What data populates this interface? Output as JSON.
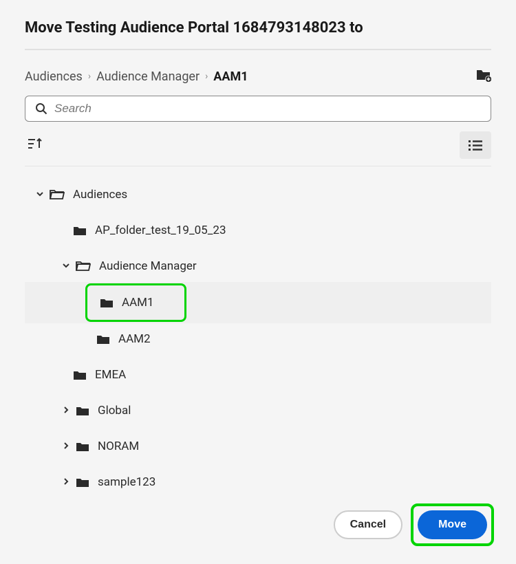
{
  "dialog": {
    "title": "Move Testing Audience Portal 1684793148023 to"
  },
  "breadcrumb": {
    "items": [
      "Audiences",
      "Audience Manager"
    ],
    "current": "AAM1"
  },
  "search": {
    "placeholder": "Search"
  },
  "tree": {
    "root": {
      "label": "Audiences",
      "expanded": true,
      "children": [
        {
          "label": "AP_folder_test_19_05_23",
          "expanded": false,
          "hasChildren": false
        },
        {
          "label": "Audience Manager",
          "expanded": true,
          "hasChildren": true,
          "children": [
            {
              "label": "AAM1",
              "selected": true
            },
            {
              "label": "AAM2"
            }
          ]
        },
        {
          "label": "EMEA",
          "expanded": false,
          "hasChildren": false
        },
        {
          "label": "Global",
          "expanded": false,
          "hasChildren": true
        },
        {
          "label": "NORAM",
          "expanded": false,
          "hasChildren": true
        },
        {
          "label": "sample123",
          "expanded": false,
          "hasChildren": true
        }
      ]
    }
  },
  "buttons": {
    "cancel": "Cancel",
    "move": "Move"
  }
}
